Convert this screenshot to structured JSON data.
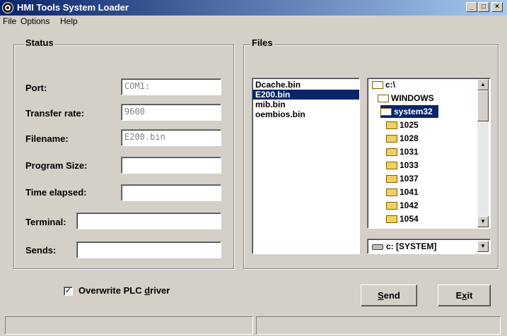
{
  "window": {
    "title": "HMI Tools System Loader",
    "minimize": "_",
    "maximize": "□",
    "close": "×"
  },
  "menu": [
    "File",
    "Options",
    "Help"
  ],
  "status": {
    "legend": "Status",
    "port_label": "Port:",
    "port_value": "COM1:",
    "rate_label": "Transfer rate:",
    "rate_value": "9600",
    "filename_label": "Filename:",
    "filename_value": "E200.bin",
    "program_size_label": "Program Size:",
    "program_size_value": "",
    "time_label": "Time elapsed:",
    "time_value": "",
    "terminal_label": "Terminal:",
    "terminal_value": "",
    "sends_label": "Sends:",
    "sends_value": ""
  },
  "files": {
    "legend": "Files",
    "list": [
      "Dcache.bin",
      "E200.bin",
      "mib.bin",
      "oembios.bin"
    ],
    "selected_index": 1,
    "tree": [
      "c:\\",
      "WINDOWS",
      "system32",
      "1025",
      "1028",
      "1031",
      "1033",
      "1037",
      "1041",
      "1042",
      "1054"
    ],
    "tree_selected_index": 2,
    "drive": "c: [SYSTEM]"
  },
  "overwrite": {
    "checked": "✓",
    "label_pre": "Overwrite PLC ",
    "label_ul": "d",
    "label_post": "river"
  },
  "buttons": {
    "send_ul": "S",
    "send_rest": "end",
    "exit_pre": "E",
    "exit_ul": "x",
    "exit_post": "it"
  }
}
